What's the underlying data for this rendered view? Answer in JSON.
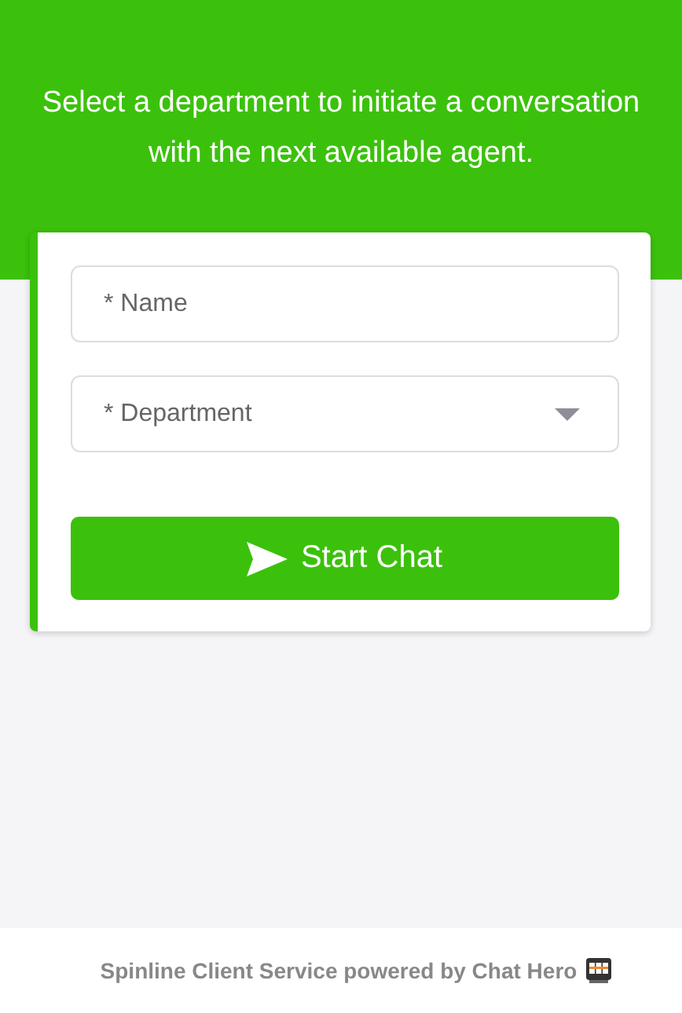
{
  "header": {
    "message": "Select a department to initiate a conversation with the next available agent."
  },
  "form": {
    "name_field": {
      "placeholder": "* Name"
    },
    "department_field": {
      "placeholder": "* Department"
    },
    "submit_button": {
      "label": "Start Chat"
    }
  },
  "footer": {
    "text": "Spinline Client Service powered by Chat Hero"
  }
}
